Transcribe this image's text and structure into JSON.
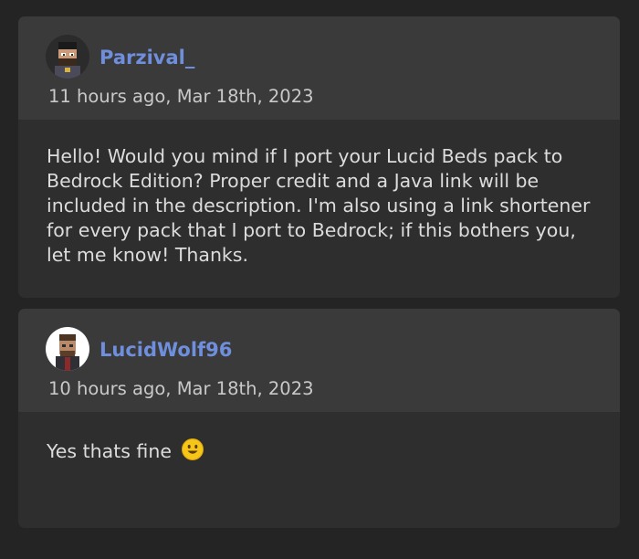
{
  "comments": [
    {
      "username": "Parzival_",
      "timestamp": "11 hours ago, Mar 18th, 2023",
      "body": "Hello! Would you mind if I port your Lucid Beds pack to Bedrock Edition? Proper credit and a Java link will be included in the description. I'm also using a link shortener for every pack that I port to Bedrock; if this bothers you, let me know! Thanks."
    },
    {
      "username": "LucidWolf96",
      "timestamp": "10 hours ago, Mar 18th, 2023",
      "body": "Yes thats fine",
      "emoji": "smiling-face-icon"
    }
  ],
  "colors": {
    "background": "#242424",
    "card": "#2e2e2e",
    "card_header": "#3a3a3a",
    "username": "#6f8fdc",
    "text": "#dcdcdc",
    "timestamp": "#c9c9c9"
  }
}
